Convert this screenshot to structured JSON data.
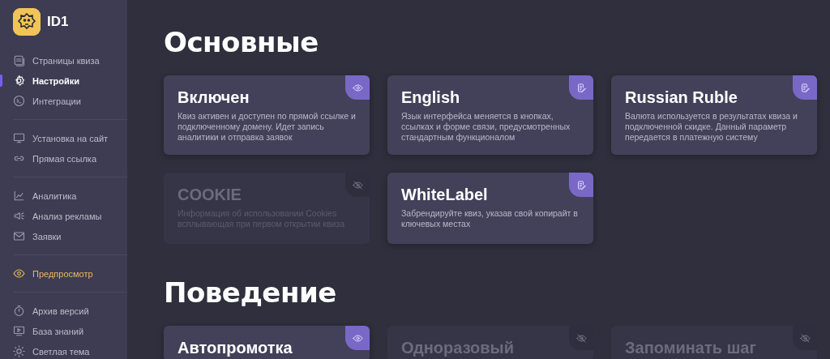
{
  "sidebar": {
    "logo": "ID1",
    "groups": [
      [
        {
          "label": "Страницы квиза",
          "selected": false,
          "highlighted": false
        },
        {
          "label": "Настройки",
          "selected": true,
          "highlighted": false
        },
        {
          "label": "Интеграции",
          "selected": false,
          "highlighted": false
        }
      ],
      [
        {
          "label": "Установка на сайт",
          "selected": false,
          "highlighted": false
        },
        {
          "label": "Прямая ссылка",
          "selected": false,
          "highlighted": false
        }
      ],
      [
        {
          "label": "Аналитика",
          "selected": false,
          "highlighted": false
        },
        {
          "label": "Анализ рекламы",
          "selected": false,
          "highlighted": false
        },
        {
          "label": "Заявки",
          "selected": false,
          "highlighted": false
        }
      ],
      [
        {
          "label": "Предпросмотр",
          "selected": false,
          "highlighted": true
        }
      ],
      [
        {
          "label": "Архив версий",
          "selected": false,
          "highlighted": false
        },
        {
          "label": "База знаний",
          "selected": false,
          "highlighted": false
        },
        {
          "label": "Светлая тема",
          "selected": false,
          "highlighted": false
        }
      ]
    ]
  },
  "sections": [
    {
      "title": "Основные",
      "cards": [
        {
          "title": "Включен",
          "description": "Квиз активен и доступен по прямой ссылке и подключенному домену. Идет запись аналитики и отправка заявок",
          "enabled": true,
          "kind": "visibility"
        },
        {
          "title": "English",
          "description": "Язык интерфейса меняется в кнопках, ссылках и форме связи, предусмотренных стандартным функционалом",
          "enabled": true,
          "kind": "editable"
        },
        {
          "title": "Russian Ruble",
          "description": "Валюта используется в результатах квиза и подключенной скидке. Данный параметр передается в платежную систему",
          "enabled": true,
          "kind": "editable"
        },
        {
          "title": "COOKIE",
          "description": "Информация об использовании Cookies всплывающая при первом открытии квиза",
          "enabled": false,
          "kind": "visibility"
        },
        {
          "title": "WhiteLabel",
          "description": "Забрендируйте квиз, указав свой копирайт в ключевых местах",
          "enabled": true,
          "kind": "editable"
        }
      ]
    },
    {
      "title": "Поведение",
      "cards": [
        {
          "title": "Автопромотка",
          "enabled": true,
          "kind": "visibility"
        },
        {
          "title": "Одноразовый",
          "enabled": false,
          "kind": "visibility"
        },
        {
          "title": "Запоминать шаг",
          "enabled": false,
          "kind": "visibility"
        }
      ]
    }
  ]
}
